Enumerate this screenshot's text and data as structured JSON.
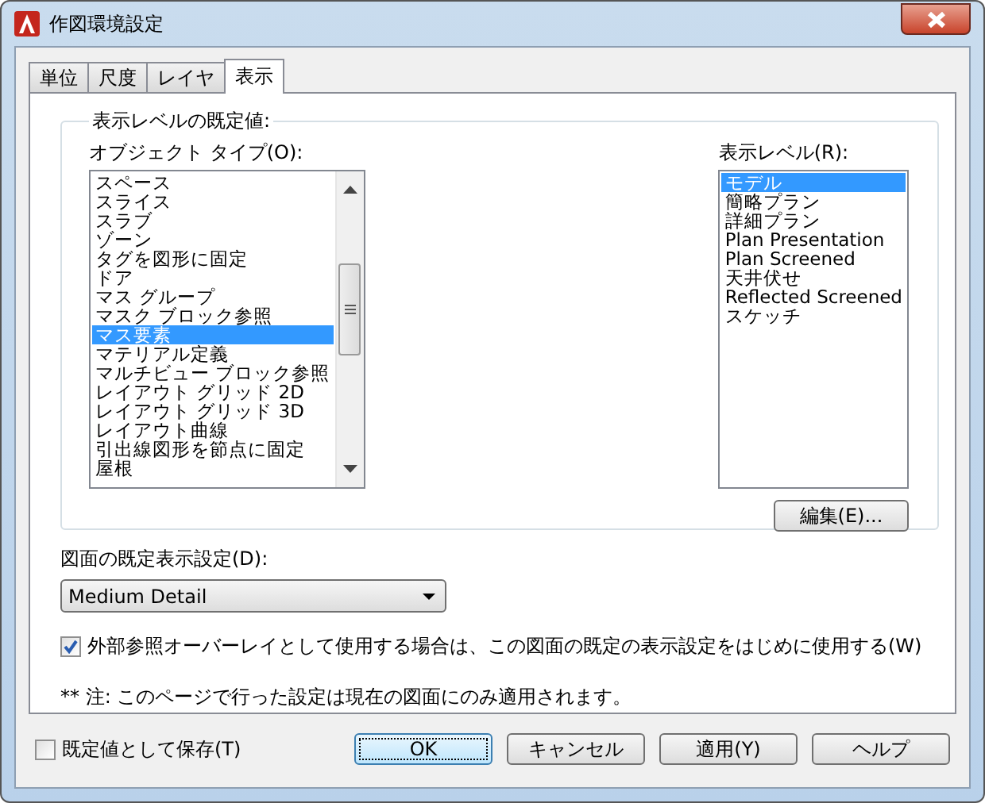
{
  "window": {
    "title": "作図環境設定"
  },
  "tabs": [
    {
      "label": "単位",
      "selected": false
    },
    {
      "label": "尺度",
      "selected": false
    },
    {
      "label": "レイヤ",
      "selected": false
    },
    {
      "label": "表示",
      "selected": true
    }
  ],
  "group": {
    "title": "表示レベルの既定値:",
    "object_types": {
      "label": "オブジェクト タイプ(O):",
      "items": [
        {
          "label": "スペース",
          "selected": false
        },
        {
          "label": "スライス",
          "selected": false
        },
        {
          "label": "スラブ",
          "selected": false
        },
        {
          "label": "ゾーン",
          "selected": false
        },
        {
          "label": "タグを図形に固定",
          "selected": false
        },
        {
          "label": "ドア",
          "selected": false
        },
        {
          "label": "マス グループ",
          "selected": false
        },
        {
          "label": "マスク ブロック参照",
          "selected": false
        },
        {
          "label": "マス要素",
          "selected": true
        },
        {
          "label": "マテリアル定義",
          "selected": false
        },
        {
          "label": "マルチビュー ブロック参照",
          "selected": false
        },
        {
          "label": "レイアウト グリッド 2D",
          "selected": false
        },
        {
          "label": "レイアウト グリッド 3D",
          "selected": false
        },
        {
          "label": "レイアウト曲線",
          "selected": false
        },
        {
          "label": "引出線図形を節点に固定",
          "selected": false
        },
        {
          "label": "屋根",
          "selected": false
        }
      ]
    },
    "display_levels": {
      "label": "表示レベル(R):",
      "items": [
        {
          "label": "モデル",
          "selected": true
        },
        {
          "label": "簡略プラン",
          "selected": false
        },
        {
          "label": "詳細プラン",
          "selected": false
        },
        {
          "label": "Plan Presentation",
          "selected": false
        },
        {
          "label": "Plan Screened",
          "selected": false
        },
        {
          "label": "天井伏せ",
          "selected": false
        },
        {
          "label": "Reflected Screened",
          "selected": false
        },
        {
          "label": "スケッチ",
          "selected": false
        }
      ]
    },
    "edit_button": "編集(E)..."
  },
  "drawing_default": {
    "label": "図面の既定表示設定(D):",
    "value": "Medium Detail"
  },
  "xref_checkbox": {
    "label": "外部参照オーバーレイとして使用する場合は、この図面の既定の表示設定をはじめに使用する(W)",
    "checked": true
  },
  "note": "** 注: このページで行った設定は現在の図面にのみ適用されます。",
  "save_default": {
    "label": "既定値として保存(T)",
    "checked": false
  },
  "buttons": [
    {
      "label": "OK",
      "kind": "default"
    },
    {
      "label": "キャンセル",
      "kind": "normal"
    },
    {
      "label": "適用(Y)",
      "kind": "normal"
    },
    {
      "label": "ヘルプ",
      "kind": "normal"
    }
  ]
}
